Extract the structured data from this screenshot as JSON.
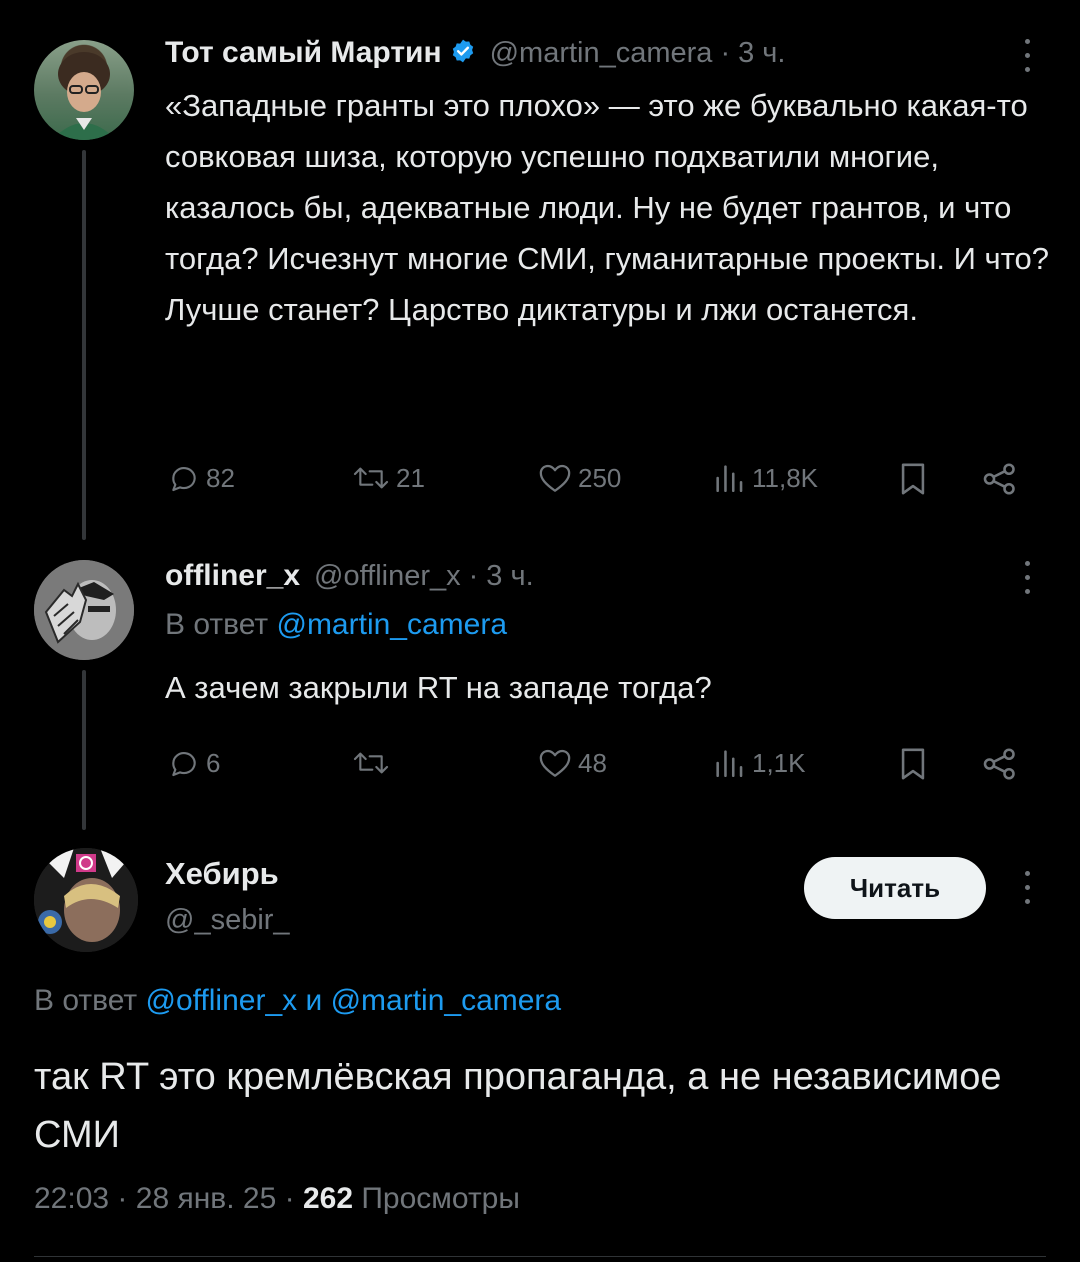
{
  "tweet1": {
    "name": "Тот самый Мартин",
    "handle": "@martin_camera",
    "sep": "·",
    "time": "3 ч.",
    "text": "«Западные гранты это плохо» — это же буквально какая-то совковая шиза, которую успешно подхватили многие, казалось бы, адекватные люди. Ну не будет грантов, и что тогда? Исчезнут многие СМИ, гуманитарные проекты. И что? Лучше станет? Царство диктатуры и лжи останется.",
    "actions": {
      "replies": "82",
      "reposts": "21",
      "likes": "250",
      "views": "11,8K"
    },
    "verified_color": "#1d9bf0"
  },
  "tweet2": {
    "name": "offliner_x",
    "handle": "@offliner_x",
    "sep": "·",
    "time": "3 ч.",
    "reply_prefix": "В ответ",
    "reply_to": "@martin_camera",
    "text": "А зачем закрыли RT на западе тогда?",
    "actions": {
      "replies": "6",
      "reposts": "",
      "likes": "48",
      "views": "1,1K"
    }
  },
  "tweet3": {
    "name": "Хебирь",
    "handle": "@_sebir_",
    "follow_label": "Читать",
    "reply_prefix": "В ответ",
    "reply_to_1": "@offliner_x",
    "reply_and": "и",
    "reply_to_2": "@martin_camera",
    "text": "так RT это кремлёвская пропаганда, а не независимое СМИ",
    "meta": {
      "time": "22:03",
      "sep1": "·",
      "date": "28 янв. 25",
      "sep2": "·",
      "views_count": "262",
      "views_label": "Просмотры"
    }
  },
  "colors": {
    "accent": "#1d9bf0",
    "muted": "#71767b",
    "background": "#000000",
    "text": "#e7e9ea"
  }
}
